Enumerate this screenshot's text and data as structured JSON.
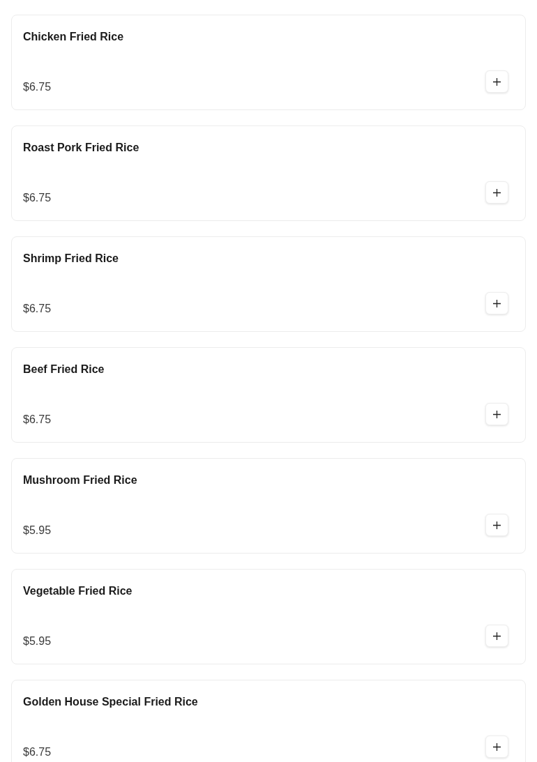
{
  "menu_items": [
    {
      "name": "Chicken Fried Rice",
      "price": "$6.75"
    },
    {
      "name": "Roast Pork Fried Rice",
      "price": "$6.75"
    },
    {
      "name": "Shrimp Fried Rice",
      "price": "$6.75"
    },
    {
      "name": "Beef Fried Rice",
      "price": "$6.75"
    },
    {
      "name": "Mushroom Fried Rice",
      "price": "$5.95"
    },
    {
      "name": "Vegetable Fried Rice",
      "price": "$5.95"
    },
    {
      "name": "Golden House Special Fried Rice",
      "price": "$6.75"
    }
  ]
}
